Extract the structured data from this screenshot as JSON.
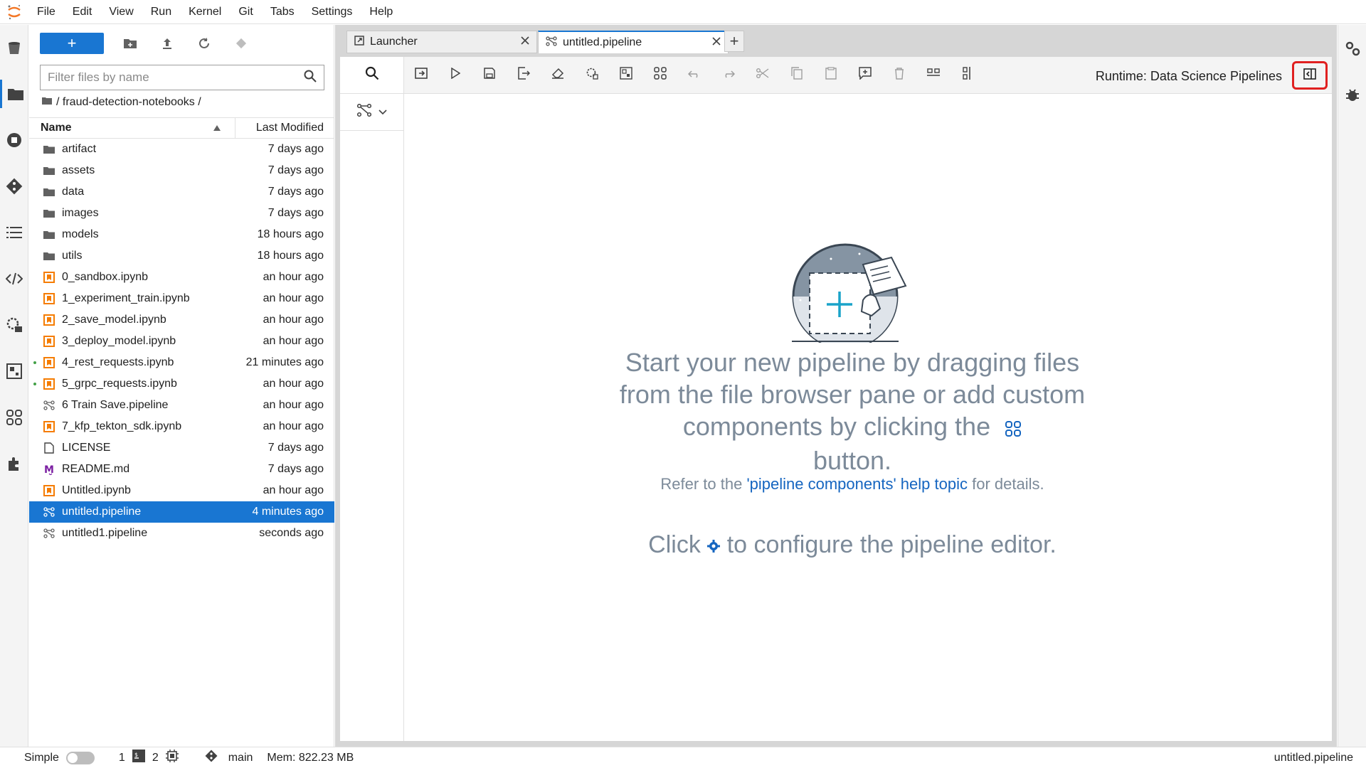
{
  "menubar": {
    "items": [
      "File",
      "Edit",
      "View",
      "Run",
      "Kernel",
      "Git",
      "Tabs",
      "Settings",
      "Help"
    ]
  },
  "filebrowser": {
    "filter_placeholder": "Filter files by name",
    "breadcrumb": "/ fraud-detection-notebooks /",
    "header_name": "Name",
    "header_modified": "Last Modified",
    "files": [
      {
        "name": "artifact",
        "modified": "7 days ago",
        "type": "folder"
      },
      {
        "name": "assets",
        "modified": "7 days ago",
        "type": "folder"
      },
      {
        "name": "data",
        "modified": "7 days ago",
        "type": "folder"
      },
      {
        "name": "images",
        "modified": "7 days ago",
        "type": "folder"
      },
      {
        "name": "models",
        "modified": "18 hours ago",
        "type": "folder"
      },
      {
        "name": "utils",
        "modified": "18 hours ago",
        "type": "folder"
      },
      {
        "name": "0_sandbox.ipynb",
        "modified": "an hour ago",
        "type": "notebook"
      },
      {
        "name": "1_experiment_train.ipynb",
        "modified": "an hour ago",
        "type": "notebook"
      },
      {
        "name": "2_save_model.ipynb",
        "modified": "an hour ago",
        "type": "notebook"
      },
      {
        "name": "3_deploy_model.ipynb",
        "modified": "an hour ago",
        "type": "notebook"
      },
      {
        "name": "4_rest_requests.ipynb",
        "modified": "21 minutes ago",
        "type": "notebook",
        "running": true
      },
      {
        "name": "5_grpc_requests.ipynb",
        "modified": "an hour ago",
        "type": "notebook",
        "running": true
      },
      {
        "name": "6 Train Save.pipeline",
        "modified": "an hour ago",
        "type": "pipeline"
      },
      {
        "name": "7_kfp_tekton_sdk.ipynb",
        "modified": "an hour ago",
        "type": "notebook"
      },
      {
        "name": "LICENSE",
        "modified": "7 days ago",
        "type": "file"
      },
      {
        "name": "README.md",
        "modified": "7 days ago",
        "type": "markdown"
      },
      {
        "name": "Untitled.ipynb",
        "modified": "an hour ago",
        "type": "notebook"
      },
      {
        "name": "untitled.pipeline",
        "modified": "4 minutes ago",
        "type": "pipeline",
        "selected": true
      },
      {
        "name": "untitled1.pipeline",
        "modified": "seconds ago",
        "type": "pipeline"
      }
    ]
  },
  "tabs": [
    {
      "label": "Launcher"
    },
    {
      "label": "untitled.pipeline"
    }
  ],
  "editor": {
    "runtime_label": "Runtime: Data Science Pipelines",
    "empty_title": "Start your new pipeline by dragging files from the file browser pane or add custom components by clicking the",
    "empty_title_end": "button.",
    "help_prefix": "Refer to the",
    "help_link": "'pipeline components' help topic",
    "help_suffix": "for details.",
    "config_prefix": "Click",
    "config_suffix": "to configure the pipeline editor."
  },
  "statusbar": {
    "mode_label": "Simple",
    "kernels_count": "1",
    "terminals_count": "2",
    "git_branch": "main",
    "memory": "Mem: 822.23 MB",
    "current_file": "untitled.pipeline"
  },
  "colors": {
    "accent": "#1976d2",
    "highlight": "#e02020",
    "notebook_orange": "#f57c00"
  }
}
